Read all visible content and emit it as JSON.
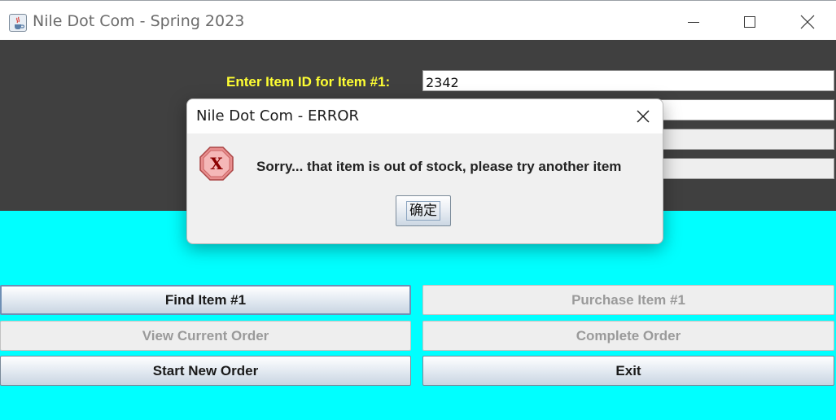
{
  "window": {
    "title": "Nile Dot Com - Spring 2023"
  },
  "form": {
    "item_id_label": "Enter Item ID for Item #1:",
    "item_id_value": "2342",
    "qty_value": "",
    "details_value": "",
    "subtotal_value": ""
  },
  "buttons": {
    "find_item": "Find Item #1",
    "purchase_item": "Purchase Item #1",
    "view_order": "View Current Order",
    "complete_order": "Complete Order",
    "start_new": "Start New Order",
    "exit": "Exit"
  },
  "dialog": {
    "title": "Nile Dot Com - ERROR",
    "message": "Sorry... that item is out of stock, please try another item",
    "ok_label": "确定"
  },
  "colors": {
    "dark_panel": "#404040",
    "cyan_panel": "#00ffff",
    "label_yellow": "#ffff33"
  }
}
